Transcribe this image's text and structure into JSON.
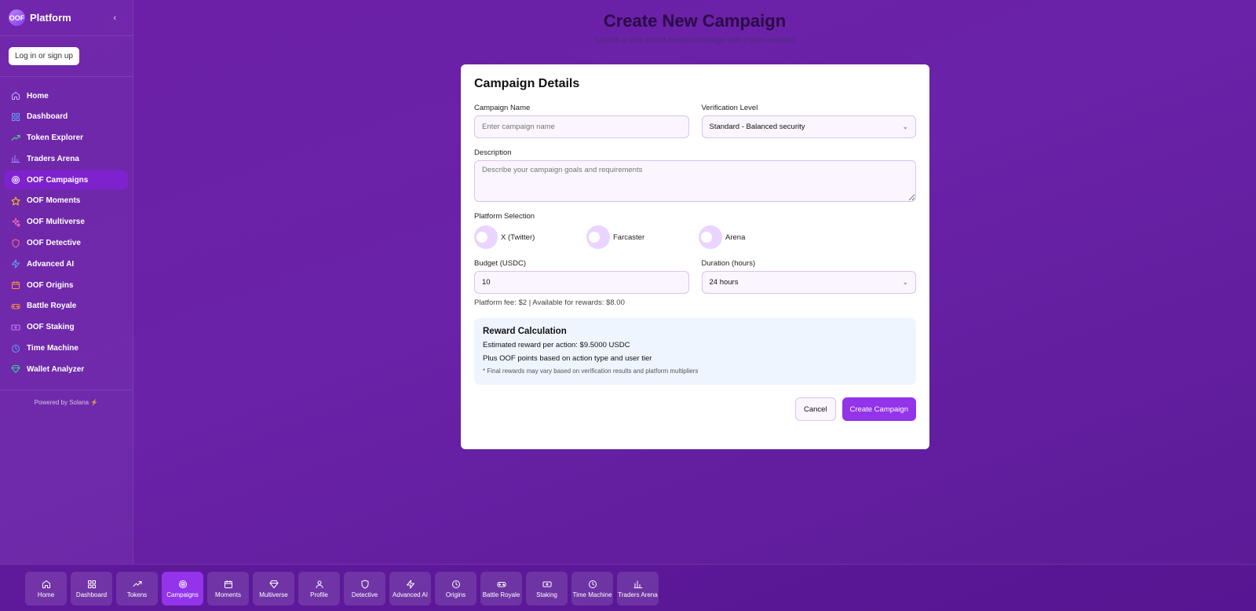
{
  "brand": {
    "logo": "OOF",
    "name": "Platform",
    "collapse": "‹"
  },
  "auth": {
    "login_label": "Log in or sign up"
  },
  "sidebar": {
    "items": [
      {
        "label": "Home",
        "icon": "home-icon",
        "color": "#c4b5fd"
      },
      {
        "label": "Dashboard",
        "icon": "grid-icon",
        "color": "#60a5fa"
      },
      {
        "label": "Token Explorer",
        "icon": "trending-up-icon",
        "color": "#4ade80"
      },
      {
        "label": "Traders Arena",
        "icon": "bar-chart-icon",
        "color": "#a78bfa"
      },
      {
        "label": "OOF Campaigns",
        "icon": "target-icon",
        "color": "#ffffff",
        "active": true
      },
      {
        "label": "OOF Moments",
        "icon": "star-icon",
        "color": "#facc15"
      },
      {
        "label": "OOF Multiverse",
        "icon": "sparkles-icon",
        "color": "#f472b6"
      },
      {
        "label": "OOF Detective",
        "icon": "shield-icon",
        "color": "#f87171"
      },
      {
        "label": "Advanced AI",
        "icon": "zap-icon",
        "color": "#60a5fa"
      },
      {
        "label": "OOF Origins",
        "icon": "calendar-icon",
        "color": "#fb923c"
      },
      {
        "label": "Battle Royale",
        "icon": "gamepad-icon",
        "color": "#fb923c"
      },
      {
        "label": "OOF Staking",
        "icon": "ticket-icon",
        "color": "#c084fc"
      },
      {
        "label": "Time Machine",
        "icon": "clock-icon",
        "color": "#60a5fa"
      },
      {
        "label": "Wallet Analyzer",
        "icon": "gem-icon",
        "color": "#34d399"
      }
    ],
    "powered": "Powered by Solana ⚡"
  },
  "header": {
    "title": "Create New Campaign",
    "subtitle": "Launch a viral social media campaign with crypto rewards"
  },
  "form": {
    "title": "Campaign Details",
    "name_label": "Campaign Name",
    "name_placeholder": "Enter campaign name",
    "verification_label": "Verification Level",
    "verification_value": "Standard - Balanced security",
    "description_label": "Description",
    "description_placeholder": "Describe your campaign goals and requirements",
    "platform_label": "Platform Selection",
    "platforms": [
      "X (Twitter)",
      "Farcaster",
      "Arena"
    ],
    "budget_label": "Budget (USDC)",
    "budget_value": "10",
    "duration_label": "Duration (hours)",
    "duration_value": "24 hours",
    "fee_text": "Platform fee: $2 | Available for rewards: $8.00",
    "reward": {
      "title": "Reward Calculation",
      "line1": "Estimated reward per action: $9.5000 USDC",
      "line2": "Plus OOF points based on action type and user tier",
      "note": "* Final rewards may vary based on verification results and platform multipliers"
    },
    "cancel_label": "Cancel",
    "submit_label": "Create Campaign"
  },
  "bottom_nav": [
    {
      "label": "Home",
      "icon": "home-icon"
    },
    {
      "label": "Dashboard",
      "icon": "grid-icon"
    },
    {
      "label": "Tokens",
      "icon": "trending-up-icon"
    },
    {
      "label": "Campaigns",
      "icon": "target-icon",
      "active": true
    },
    {
      "label": "Moments",
      "icon": "calendar-icon"
    },
    {
      "label": "Multiverse",
      "icon": "gem-icon"
    },
    {
      "label": "Profile",
      "icon": "user-icon"
    },
    {
      "label": "Detective",
      "icon": "shield-icon"
    },
    {
      "label": "Advanced AI",
      "icon": "zap-icon"
    },
    {
      "label": "Origins",
      "icon": "clock-icon"
    },
    {
      "label": "Battle Royale",
      "icon": "gamepad-icon"
    },
    {
      "label": "Staking",
      "icon": "ticket-icon"
    },
    {
      "label": "Time Machine",
      "icon": "clock-icon"
    },
    {
      "label": "Traders Arena",
      "icon": "bar-chart-icon"
    }
  ]
}
